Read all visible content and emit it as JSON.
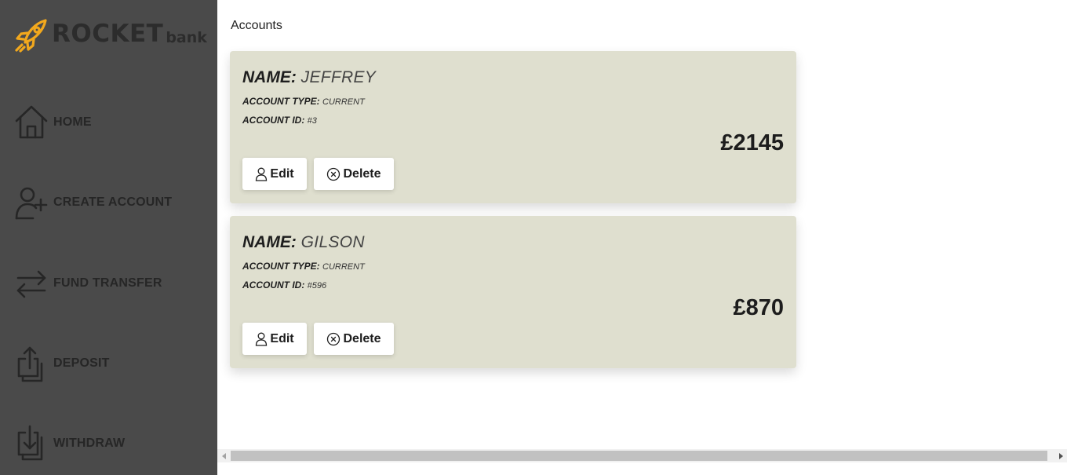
{
  "brand": {
    "name": "ROCKET",
    "sub": "bank"
  },
  "sidebar": {
    "items": [
      {
        "label": "HOME",
        "icon": "home-icon"
      },
      {
        "label": "CREATE ACCOUNT",
        "icon": "add-user-icon"
      },
      {
        "label": "FUND TRANSFER",
        "icon": "transfer-arrows-icon"
      },
      {
        "label": "DEPOSIT",
        "icon": "upload-icon"
      },
      {
        "label": "WITHDRAW",
        "icon": "download-icon"
      }
    ]
  },
  "main": {
    "title": "Accounts",
    "accounts": [
      {
        "name_key": "NAME:",
        "name": "JEFFREY",
        "type_key": "ACCOUNT TYPE:",
        "type": "CURRENT",
        "id_key": "ACCOUNT ID:",
        "id": "#3",
        "balance": "£2145",
        "edit_label": "Edit",
        "delete_label": "Delete"
      },
      {
        "name_key": "NAME:",
        "name": "GILSON",
        "type_key": "ACCOUNT TYPE:",
        "type": "CURRENT",
        "id_key": "ACCOUNT ID:",
        "id": "#596",
        "balance": "£870",
        "edit_label": "Edit",
        "delete_label": "Delete"
      }
    ]
  },
  "colors": {
    "sidebar": "#4a4a4a",
    "card": "#dfdfcf",
    "logo_accent": "#f2a81d",
    "text_dark": "#1d1d1d"
  }
}
